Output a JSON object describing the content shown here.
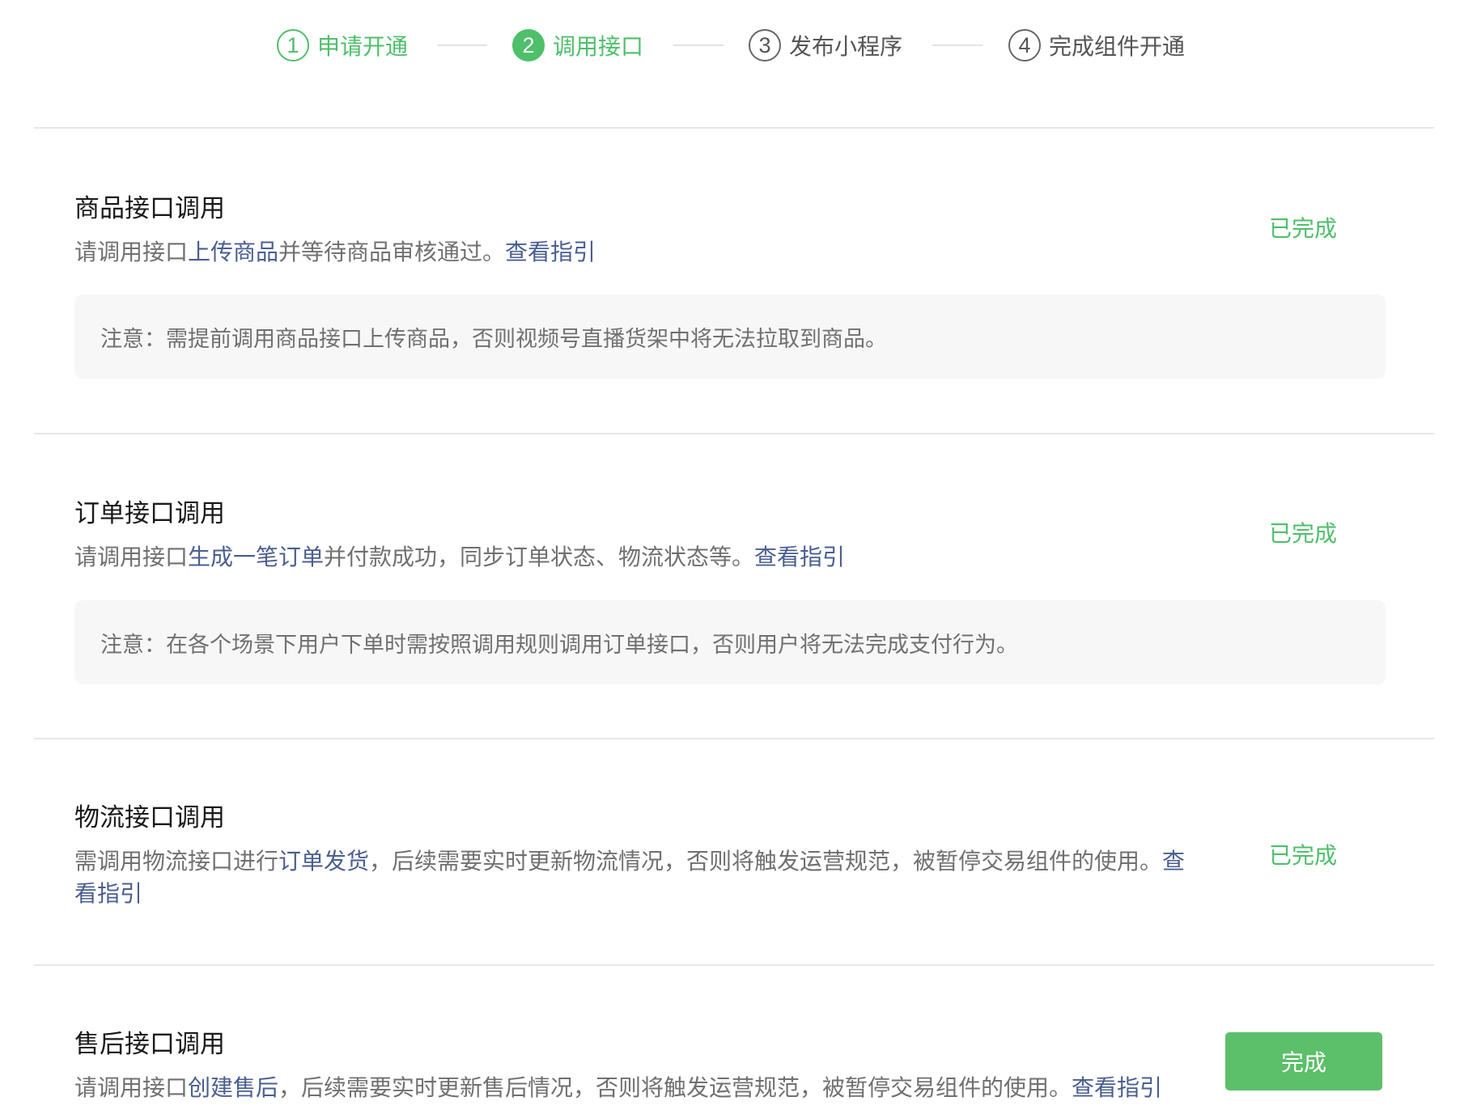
{
  "stepper": {
    "steps": [
      {
        "num": "1",
        "label": "申请开通",
        "state": "done"
      },
      {
        "num": "2",
        "label": "调用接口",
        "state": "current"
      },
      {
        "num": "3",
        "label": "发布小程序",
        "state": "todo"
      },
      {
        "num": "4",
        "label": "完成组件开通",
        "state": "todo"
      }
    ]
  },
  "sections": [
    {
      "title": "商品接口调用",
      "desc_prefix": "请调用接口",
      "desc_link": "上传商品",
      "desc_middle": "并等待商品审核通过。",
      "guide_link": "查看指引",
      "notice": "注意：需提前调用商品接口上传商品，否则视频号直播货架中将无法拉取到商品。",
      "status": "已完成"
    },
    {
      "title": "订单接口调用",
      "desc_prefix": "请调用接口",
      "desc_link": "生成一笔订单",
      "desc_middle": "并付款成功，同步订单状态、物流状态等。",
      "guide_link": "查看指引",
      "notice": "注意：在各个场景下用户下单时需按照调用规则调用订单接口，否则用户将无法完成支付行为。",
      "status": "已完成"
    },
    {
      "title": "物流接口调用",
      "desc_prefix": "需调用物流接口进行",
      "desc_link": "订单发货",
      "desc_middle": "，后续需要实时更新物流情况，否则将触发运营规范，被暂停交易组件的使用。",
      "guide_link": "查看指引",
      "status": "已完成"
    },
    {
      "title": "售后接口调用",
      "desc_prefix": "请调用接口",
      "desc_link": "创建售后",
      "desc_middle": "，后续需要实时更新售后情况，否则将触发运营规范，被暂停交易组件的使用。",
      "guide_link": "查看指引",
      "button": "完成"
    }
  ],
  "colors": {
    "accent_green": "#4ebf6a",
    "button_green": "#5cbf6a",
    "link_blue": "#4a5e90",
    "text_gray": "#707070",
    "notice_bg": "#f7f7f7"
  }
}
